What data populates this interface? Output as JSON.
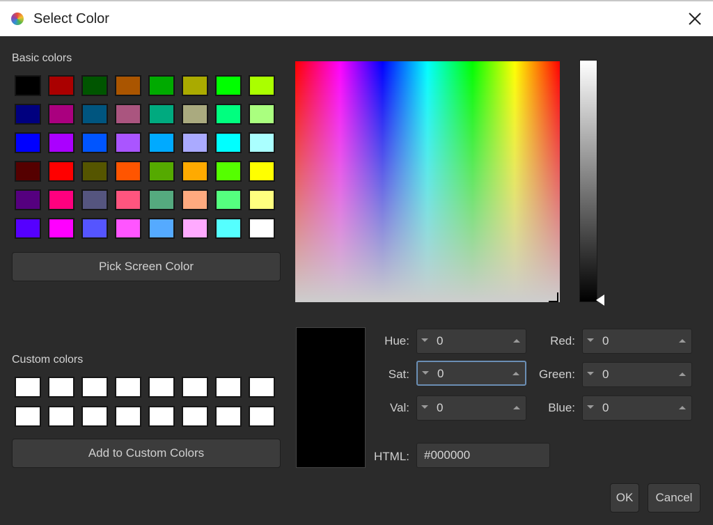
{
  "window": {
    "title": "Select Color",
    "icon": "color-wheel-icon",
    "close_icon": "close-icon"
  },
  "basic_colors": {
    "label": "Basic colors",
    "swatches": [
      "#000000",
      "#aa0000",
      "#005500",
      "#aa5500",
      "#00aa00",
      "#aaaa00",
      "#00ff00",
      "#aaff00",
      "#00007f",
      "#aa007f",
      "#00557f",
      "#aa557f",
      "#00aa7f",
      "#aaaa7f",
      "#00ff7f",
      "#aaff7f",
      "#0000ff",
      "#aa00ff",
      "#0055ff",
      "#aa55ff",
      "#00aaff",
      "#aaaaff",
      "#00ffff",
      "#aaffff",
      "#550000",
      "#ff0000",
      "#555500",
      "#ff5500",
      "#55aa00",
      "#ffaa00",
      "#55ff00",
      "#ffff00",
      "#55007f",
      "#ff007f",
      "#55557f",
      "#ff557f",
      "#55aa7f",
      "#ffaa7f",
      "#55ff7f",
      "#ffff7f",
      "#5500ff",
      "#ff00ff",
      "#5555ff",
      "#ff55ff",
      "#55aaff",
      "#ffaaff",
      "#55ffff",
      "#ffffff"
    ]
  },
  "pick_screen_color_label": "Pick Screen Color",
  "custom_colors": {
    "label": "Custom colors",
    "swatches": [
      "#ffffff",
      "#ffffff",
      "#ffffff",
      "#ffffff",
      "#ffffff",
      "#ffffff",
      "#ffffff",
      "#ffffff",
      "#ffffff",
      "#ffffff",
      "#ffffff",
      "#ffffff",
      "#ffffff",
      "#ffffff",
      "#ffffff",
      "#ffffff"
    ]
  },
  "add_custom_label": "Add to Custom Colors",
  "current_color": "#000000",
  "fields": {
    "hue": {
      "label": "Hue:",
      "value": "0"
    },
    "sat": {
      "label": "Sat:",
      "value": "0"
    },
    "val": {
      "label": "Val:",
      "value": "0"
    },
    "red": {
      "label": "Red:",
      "value": "0"
    },
    "green": {
      "label": "Green:",
      "value": "0"
    },
    "blue": {
      "label": "Blue:",
      "value": "0"
    },
    "html": {
      "label": "HTML:",
      "value": "#000000"
    }
  },
  "buttons": {
    "ok": "OK",
    "cancel": "Cancel"
  }
}
